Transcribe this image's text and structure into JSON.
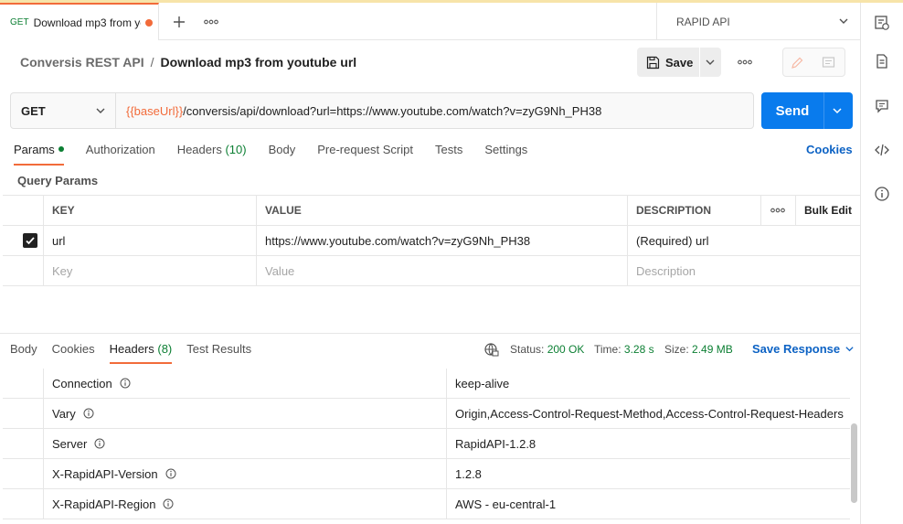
{
  "tab": {
    "method": "GET",
    "title": "Download mp3 from youtube url"
  },
  "environment": {
    "name": "RAPID API"
  },
  "breadcrumb": {
    "collection": "Conversis REST API",
    "separator": "/",
    "request": "Download mp3 from youtube url"
  },
  "toolbar": {
    "save_label": "Save"
  },
  "request": {
    "method": "GET",
    "url_variable": "{{baseUrl}}",
    "url_path": "/conversis/api/download?url=https://www.youtube.com/watch?v=zyG9Nh_PH38",
    "send_label": "Send"
  },
  "request_tabs": {
    "params": "Params",
    "authorization": "Authorization",
    "headers": "Headers",
    "headers_count": "(10)",
    "body": "Body",
    "prerequest": "Pre-request Script",
    "tests": "Tests",
    "settings": "Settings",
    "cookies": "Cookies"
  },
  "query_params": {
    "label": "Query Params",
    "columns": {
      "key": "KEY",
      "value": "VALUE",
      "description": "DESCRIPTION",
      "bulk_edit": "Bulk Edit"
    },
    "rows": [
      {
        "key": "url",
        "value": "https://www.youtube.com/watch?v=zyG9Nh_PH38",
        "description": "(Required) url",
        "checked": true
      }
    ],
    "placeholder": {
      "key": "Key",
      "value": "Value",
      "description": "Description"
    }
  },
  "response": {
    "tabs": {
      "body": "Body",
      "cookies": "Cookies",
      "headers": "Headers",
      "headers_count": "(8)",
      "test_results": "Test Results"
    },
    "status_label": "Status:",
    "status_value": "200 OK",
    "time_label": "Time:",
    "time_value": "3.28 s",
    "size_label": "Size:",
    "size_value": "2.49 MB",
    "save_response": "Save Response",
    "headers": [
      {
        "key": "Connection",
        "value": "keep-alive"
      },
      {
        "key": "Vary",
        "value": "Origin,Access-Control-Request-Method,Access-Control-Request-Headers"
      },
      {
        "key": "Server",
        "value": "RapidAPI-1.2.8"
      },
      {
        "key": "X-RapidAPI-Version",
        "value": "1.2.8"
      },
      {
        "key": "X-RapidAPI-Region",
        "value": "AWS - eu-central-1"
      }
    ]
  },
  "colors": {
    "accent": "#f26b3a",
    "send": "#097bed",
    "link": "#0c62c4",
    "success": "#0c7f33"
  }
}
